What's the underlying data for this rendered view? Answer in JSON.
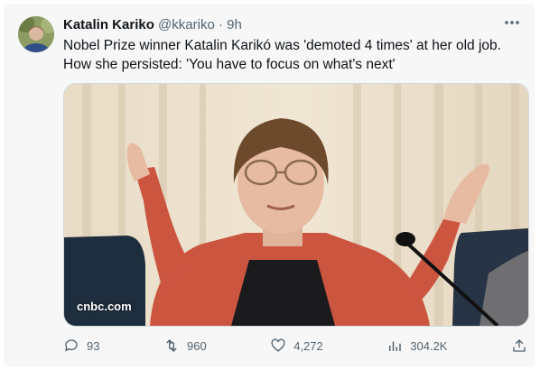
{
  "tweet": {
    "author_name": "Katalin Kariko",
    "handle": "@kkariko",
    "separator": "·",
    "time": "9h",
    "text_line1": "Nobel Prize winner Katalin Karikó was 'demoted 4 times' at her old job.",
    "text_line2": "How she persisted: 'You have to focus on what's next'",
    "media_source": "cnbc.com",
    "more_icon": "more-horizontal-icon"
  },
  "actions": {
    "replies": "93",
    "retweets": "960",
    "likes": "4,272",
    "views": "304.2K"
  },
  "colors": {
    "text": "#0f1419",
    "secondary": "#536471",
    "card_bg": "#f7f7f7"
  }
}
